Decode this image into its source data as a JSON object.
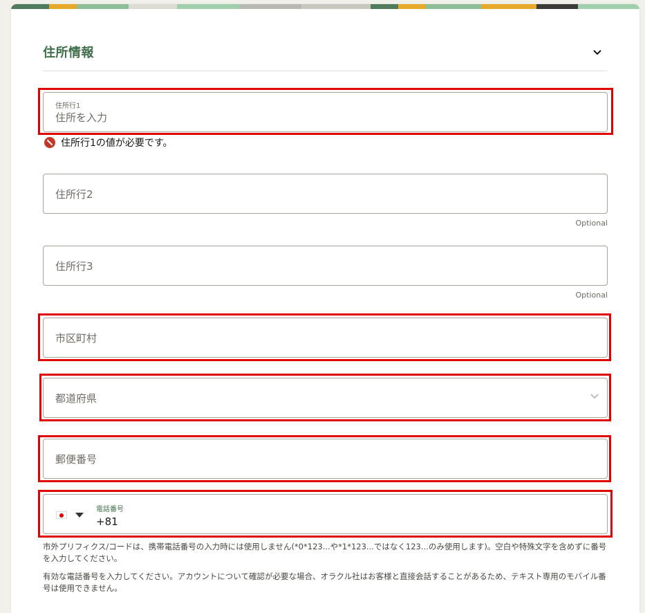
{
  "section": {
    "title": "住所情報",
    "collapse_icon": "chevron-down-icon"
  },
  "fields": {
    "address1": {
      "label": "住所行1",
      "placeholder": "住所を入力",
      "error": "住所行1の値が必要です。"
    },
    "address2": {
      "placeholder": "住所行2",
      "note": "Optional"
    },
    "address3": {
      "placeholder": "住所行3",
      "note": "Optional"
    },
    "city": {
      "placeholder": "市区町村"
    },
    "prefecture": {
      "placeholder": "都道府県",
      "icon": "chevron-down-icon"
    },
    "postal": {
      "placeholder": "郵便番号"
    },
    "phone": {
      "label": "電話番号",
      "value": "+81",
      "country_flag": "japan-flag-icon"
    }
  },
  "hints": {
    "prefix": "市外プリフィクス/コードは、携帯電話番号の入力時には使用しません(*0*123...や*1*123...ではなく123...のみ使用します)。空白や特殊文字を含めずに番号を入力してください。",
    "mobile": "有効な電話番号を入力してください。アカウントについて確認が必要な場合、オラクル社はお客様と直接会話することがあるため、テキスト専用のモバイル番号は使用できません。"
  },
  "colors": {
    "accent": "#3f6f4b",
    "highlight": "#e00000",
    "error_icon": "#c0392b"
  }
}
